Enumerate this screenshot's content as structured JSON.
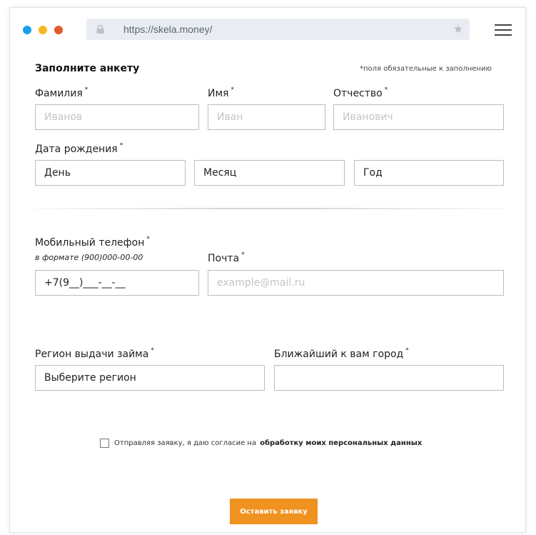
{
  "browser": {
    "url": "https://skela.money/",
    "icons": {
      "lock": "lock-icon",
      "bookmark": "star-icon",
      "menu": "hamburger-menu-icon"
    }
  },
  "form": {
    "title": "Заполните анкету",
    "required_note": "*поля обязательные к заполнению",
    "required_mark": "*",
    "last_name": {
      "label": "Фамилия",
      "placeholder": "Иванов"
    },
    "first_name": {
      "label": "Имя",
      "placeholder": "Иван"
    },
    "patronymic": {
      "label": "Отчество",
      "placeholder": "Иванович"
    },
    "birth_date": {
      "label": "Дата рождения",
      "day": "День",
      "month": "Месяц",
      "year": "Год"
    },
    "phone": {
      "label": "Мобильный телефон",
      "hint": "в формате (900)000-00-00",
      "value": "+7(9__)___-__-__"
    },
    "email": {
      "label": "Почта",
      "placeholder": "example@mail.ru"
    },
    "region": {
      "label": "Регион выдачи займа",
      "value": "Выберите регион"
    },
    "city": {
      "label": "Ближайший к вам город",
      "value": ""
    },
    "consent": {
      "text": "Отправляя заявку, я даю согласие на",
      "link": "обработку моих персональных данных",
      "checked": false
    },
    "submit_label": "Оставить заявку"
  },
  "colors": {
    "accent": "#f0921f",
    "dot_blue": "#1aa0e8",
    "dot_yellow": "#f5b820",
    "dot_red": "#e25a2c"
  }
}
